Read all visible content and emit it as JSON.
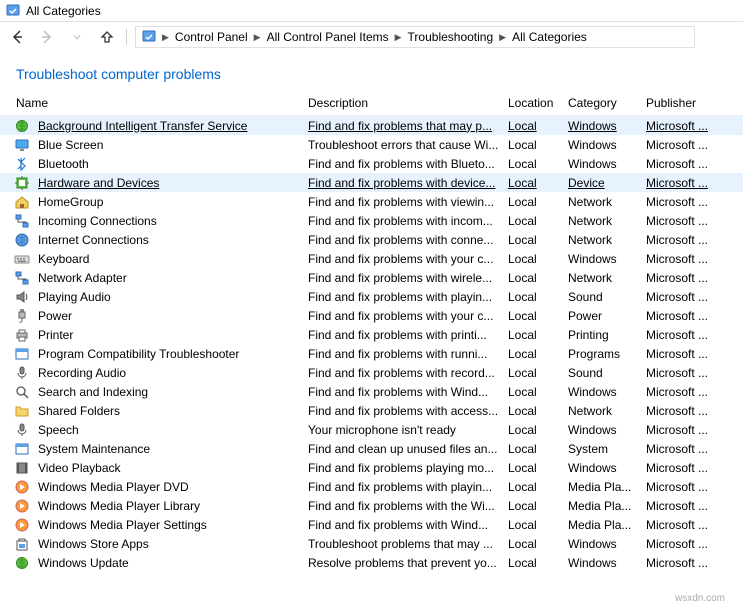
{
  "window": {
    "title": "All Categories"
  },
  "breadcrumb": {
    "items": [
      "Control Panel",
      "All Control Panel Items",
      "Troubleshooting",
      "All Categories"
    ]
  },
  "heading": "Troubleshoot computer problems",
  "columns": {
    "name": "Name",
    "description": "Description",
    "location": "Location",
    "category": "Category",
    "publisher": "Publisher"
  },
  "items": [
    {
      "name": "Background Intelligent Transfer Service",
      "description": "Find and fix problems that may p...",
      "location": "Local",
      "category": "Windows",
      "publisher": "Microsoft ...",
      "highlight": true,
      "underline": true,
      "icon": "globe-arrows"
    },
    {
      "name": "Blue Screen",
      "description": "Troubleshoot errors that cause Wi...",
      "location": "Local",
      "category": "Windows",
      "publisher": "Microsoft ...",
      "icon": "monitor"
    },
    {
      "name": "Bluetooth",
      "description": "Find and fix problems with Blueto...",
      "location": "Local",
      "category": "Windows",
      "publisher": "Microsoft ...",
      "icon": "bluetooth"
    },
    {
      "name": "Hardware and Devices",
      "description": "Find and fix problems with device...",
      "location": "Local",
      "category": "Device",
      "publisher": "Microsoft ...",
      "highlight": true,
      "icon": "chip"
    },
    {
      "name": "HomeGroup",
      "description": "Find and fix problems with viewin...",
      "location": "Local",
      "category": "Network",
      "publisher": "Microsoft ...",
      "icon": "home"
    },
    {
      "name": "Incoming Connections",
      "description": "Find and fix problems with incom...",
      "location": "Local",
      "category": "Network",
      "publisher": "Microsoft ...",
      "icon": "network"
    },
    {
      "name": "Internet Connections",
      "description": "Find and fix problems with conne...",
      "location": "Local",
      "category": "Network",
      "publisher": "Microsoft ...",
      "icon": "globe"
    },
    {
      "name": "Keyboard",
      "description": "Find and fix problems with your c...",
      "location": "Local",
      "category": "Windows",
      "publisher": "Microsoft ...",
      "icon": "keyboard"
    },
    {
      "name": "Network Adapter",
      "description": "Find and fix problems with wirele...",
      "location": "Local",
      "category": "Network",
      "publisher": "Microsoft ...",
      "icon": "network"
    },
    {
      "name": "Playing Audio",
      "description": "Find and fix problems with playin...",
      "location": "Local",
      "category": "Sound",
      "publisher": "Microsoft ...",
      "icon": "speaker"
    },
    {
      "name": "Power",
      "description": "Find and fix problems with your c...",
      "location": "Local",
      "category": "Power",
      "publisher": "Microsoft ...",
      "icon": "plug"
    },
    {
      "name": "Printer",
      "description": "Find and fix problems with printi...",
      "location": "Local",
      "category": "Printing",
      "publisher": "Microsoft ...",
      "icon": "printer"
    },
    {
      "name": "Program Compatibility Troubleshooter",
      "description": "Find and fix problems with runni...",
      "location": "Local",
      "category": "Programs",
      "publisher": "Microsoft ...",
      "icon": "window"
    },
    {
      "name": "Recording Audio",
      "description": "Find and fix problems with record...",
      "location": "Local",
      "category": "Sound",
      "publisher": "Microsoft ...",
      "icon": "mic"
    },
    {
      "name": "Search and Indexing",
      "description": "Find and fix problems with Wind...",
      "location": "Local",
      "category": "Windows",
      "publisher": "Microsoft ...",
      "icon": "search"
    },
    {
      "name": "Shared Folders",
      "description": "Find and fix problems with access...",
      "location": "Local",
      "category": "Network",
      "publisher": "Microsoft ...",
      "icon": "folder"
    },
    {
      "name": "Speech",
      "description": "Your microphone isn't ready",
      "location": "Local",
      "category": "Windows",
      "publisher": "Microsoft ...",
      "icon": "mic"
    },
    {
      "name": "System Maintenance",
      "description": "Find and clean up unused files an...",
      "location": "Local",
      "category": "System",
      "publisher": "Microsoft ...",
      "icon": "window"
    },
    {
      "name": "Video Playback",
      "description": "Find and fix problems playing mo...",
      "location": "Local",
      "category": "Windows",
      "publisher": "Microsoft ...",
      "icon": "film"
    },
    {
      "name": "Windows Media Player DVD",
      "description": "Find and fix problems with playin...",
      "location": "Local",
      "category": "Media Pla...",
      "publisher": "Microsoft ...",
      "icon": "media"
    },
    {
      "name": "Windows Media Player Library",
      "description": "Find and fix problems with the Wi...",
      "location": "Local",
      "category": "Media Pla...",
      "publisher": "Microsoft ...",
      "icon": "media"
    },
    {
      "name": "Windows Media Player Settings",
      "description": "Find and fix problems with Wind...",
      "location": "Local",
      "category": "Media Pla...",
      "publisher": "Microsoft ...",
      "icon": "media"
    },
    {
      "name": "Windows Store Apps",
      "description": "Troubleshoot problems that may ...",
      "location": "Local",
      "category": "Windows",
      "publisher": "Microsoft ...",
      "icon": "store"
    },
    {
      "name": "Windows Update",
      "description": "Resolve problems that prevent yo...",
      "location": "Local",
      "category": "Windows",
      "publisher": "Microsoft ...",
      "icon": "globe-arrows"
    }
  ],
  "watermark": "wsxdn.com"
}
